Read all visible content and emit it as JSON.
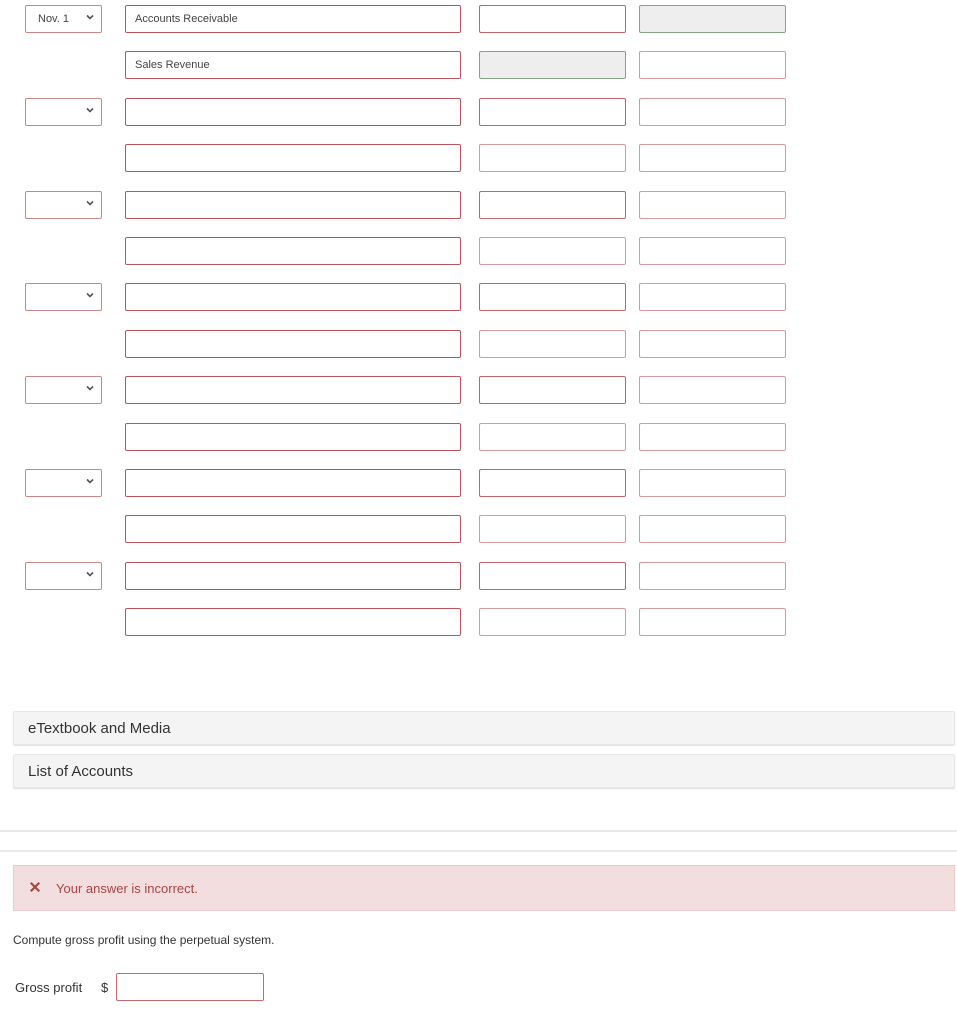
{
  "journal": {
    "entries": [
      {
        "date": "Nov. 1",
        "lines": [
          {
            "account": "Accounts Receivable",
            "debit": "",
            "credit": "",
            "debit_locked": false,
            "credit_locked": true
          },
          {
            "account": "Sales Revenue",
            "debit": "",
            "credit": "",
            "debit_locked": true,
            "credit_locked": false
          }
        ]
      },
      {
        "date": "",
        "lines": [
          {
            "account": "",
            "debit": "",
            "credit": ""
          },
          {
            "account": "",
            "debit": "",
            "credit": ""
          }
        ]
      },
      {
        "date": "",
        "lines": [
          {
            "account": "",
            "debit": "",
            "credit": ""
          },
          {
            "account": "",
            "debit": "",
            "credit": ""
          }
        ]
      },
      {
        "date": "",
        "lines": [
          {
            "account": "",
            "debit": "",
            "credit": ""
          },
          {
            "account": "",
            "debit": "",
            "credit": ""
          }
        ]
      },
      {
        "date": "",
        "lines": [
          {
            "account": "",
            "debit": "",
            "credit": ""
          },
          {
            "account": "",
            "debit": "",
            "credit": ""
          }
        ]
      },
      {
        "date": "",
        "lines": [
          {
            "account": "",
            "debit": "",
            "credit": ""
          },
          {
            "account": "",
            "debit": "",
            "credit": ""
          }
        ]
      },
      {
        "date": "",
        "lines": [
          {
            "account": "",
            "debit": "",
            "credit": ""
          },
          {
            "account": "",
            "debit": "",
            "credit": ""
          }
        ]
      }
    ]
  },
  "resources": {
    "etextbook_label": "eTextbook and Media",
    "list_of_accounts_label": "List of Accounts"
  },
  "feedback": {
    "icon": "x-mark-icon",
    "message": "Your answer is incorrect.",
    "color": "#a94442",
    "background": "#f2dede"
  },
  "question": {
    "prompt": "Compute gross profit using the perpetual system.",
    "gross_profit_label": "Gross profit",
    "currency_symbol": "$",
    "gross_profit_value": ""
  }
}
